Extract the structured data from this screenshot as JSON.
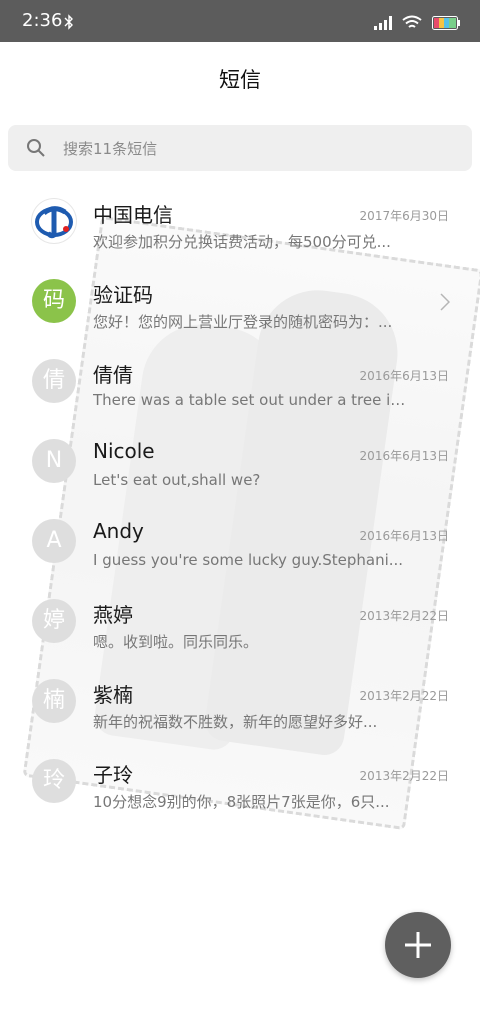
{
  "status_bar": {
    "time": "2:36"
  },
  "header": {
    "title": "短信"
  },
  "search": {
    "placeholder": "搜索11条短信"
  },
  "conversations": [
    {
      "name": "中国电信",
      "date": "2017年6月30日",
      "preview": "欢迎参加积分兑换话费活动，每500分可兑...",
      "avatar_type": "logo",
      "avatar": "china-telecom-logo"
    },
    {
      "name": "验证码",
      "date": "",
      "preview": "您好！您的网上营业厅登录的随机密码为：...",
      "avatar_type": "green",
      "avatar": "码"
    },
    {
      "name": "倩倩",
      "date": "2016年6月13日",
      "preview": "There was a table set out under a tree in...",
      "avatar_type": "gray",
      "avatar": "倩"
    },
    {
      "name": "Nicole",
      "date": "2016年6月13日",
      "preview": "Let's eat out,shall we?",
      "avatar_type": "gray",
      "avatar": "N"
    },
    {
      "name": "Andy",
      "date": "2016年6月13日",
      "preview": "I guess you're some lucky guy.Stephani...",
      "avatar_type": "gray",
      "avatar": "A"
    },
    {
      "name": "燕婷",
      "date": "2013年2月22日",
      "preview": "嗯。收到啦。同乐同乐。",
      "avatar_type": "gray",
      "avatar": "婷"
    },
    {
      "name": "紫楠",
      "date": "2013年2月22日",
      "preview": "新年的祝福数不胜数，新年的愿望好多好...",
      "avatar_type": "gray",
      "avatar": "楠"
    },
    {
      "name": "子玲",
      "date": "2013年2月22日",
      "preview": "10分想念9别的你，8张照片7张是你，6只...",
      "avatar_type": "gray",
      "avatar": "玲"
    }
  ],
  "colors": {
    "status_bar": "#5c5c5c",
    "fab": "#5f5f5f",
    "green_avatar": "#8bc34a",
    "gray_avatar": "#dedede"
  }
}
